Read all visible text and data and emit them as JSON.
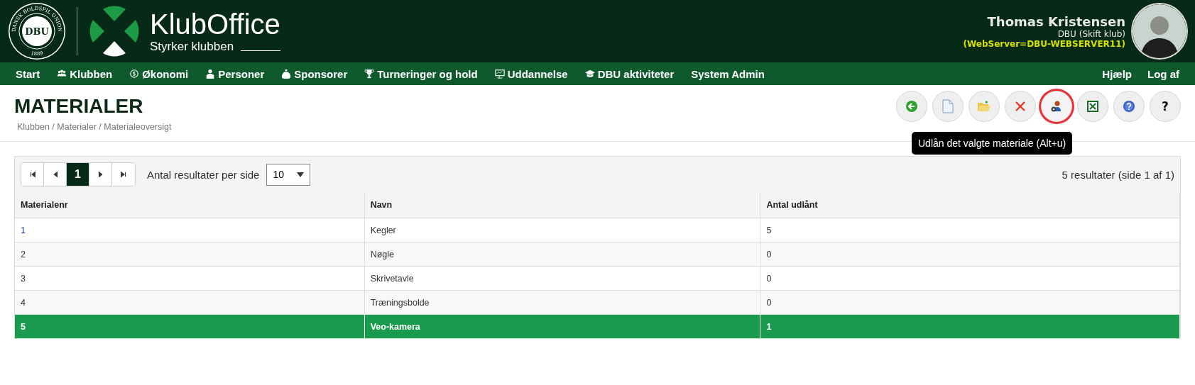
{
  "logo": {
    "ring_top": "DANSK BOLDSPIL UNION",
    "initials": "DBU",
    "year": "1889"
  },
  "brand": {
    "name": "KlubOffice",
    "tagline": "Styrker klubben"
  },
  "user": {
    "name": "Thomas Kristensen",
    "club": "DBU (Skift klub)",
    "server": "(WebServer=DBU-WEBSERVER11)"
  },
  "nav": [
    {
      "label": "Start",
      "kind": "plain"
    },
    {
      "label": "Klubben",
      "kind": "people"
    },
    {
      "label": "Økonomi",
      "kind": "coin"
    },
    {
      "label": "Personer",
      "kind": "person"
    },
    {
      "label": "Sponsorer",
      "kind": "bag"
    },
    {
      "label": "Turneringer og hold",
      "kind": "trophy"
    },
    {
      "label": "Uddannelse",
      "kind": "board"
    },
    {
      "label": "DBU aktiviteter",
      "kind": "cap"
    },
    {
      "label": "System Admin",
      "kind": "plain"
    }
  ],
  "nav_right": [
    {
      "label": "Hjælp"
    },
    {
      "label": "Log af"
    }
  ],
  "page": {
    "title": "MATERIALER",
    "breadcrumb": "Klubben / Materialer / Materialeoversigt"
  },
  "toolbar": [
    {
      "kind": "back",
      "highlighted": false
    },
    {
      "kind": "new",
      "highlighted": false
    },
    {
      "kind": "open",
      "highlighted": false
    },
    {
      "kind": "delete",
      "highlighted": false
    },
    {
      "kind": "lend",
      "highlighted": true
    },
    {
      "kind": "excel",
      "highlighted": false
    },
    {
      "kind": "help",
      "highlighted": false
    },
    {
      "kind": "question",
      "label": "?",
      "highlighted": false
    }
  ],
  "tooltip": "Udlån det valgte materiale (Alt+u)",
  "pager": {
    "pages": [
      {
        "label": "1",
        "selected": true
      }
    ],
    "per_page_label": "Antal resultater per side",
    "per_page": "10",
    "summary": "5 resultater (side 1 af 1)"
  },
  "table": {
    "columns": [
      "Materialenr",
      "Navn",
      "Antal udlånt"
    ],
    "rows": [
      {
        "cells": [
          "1",
          "Kegler",
          "5"
        ],
        "linked": true,
        "selected": false
      },
      {
        "cells": [
          "2",
          "Nøgle",
          "0"
        ],
        "linked": false,
        "selected": false
      },
      {
        "cells": [
          "3",
          "Skrivetavle",
          "0"
        ],
        "linked": false,
        "selected": false
      },
      {
        "cells": [
          "4",
          "Træningsbolde",
          "0"
        ],
        "linked": false,
        "selected": false
      },
      {
        "cells": [
          "5",
          "Veo-kamera",
          "1"
        ],
        "linked": false,
        "selected": true
      }
    ]
  }
}
